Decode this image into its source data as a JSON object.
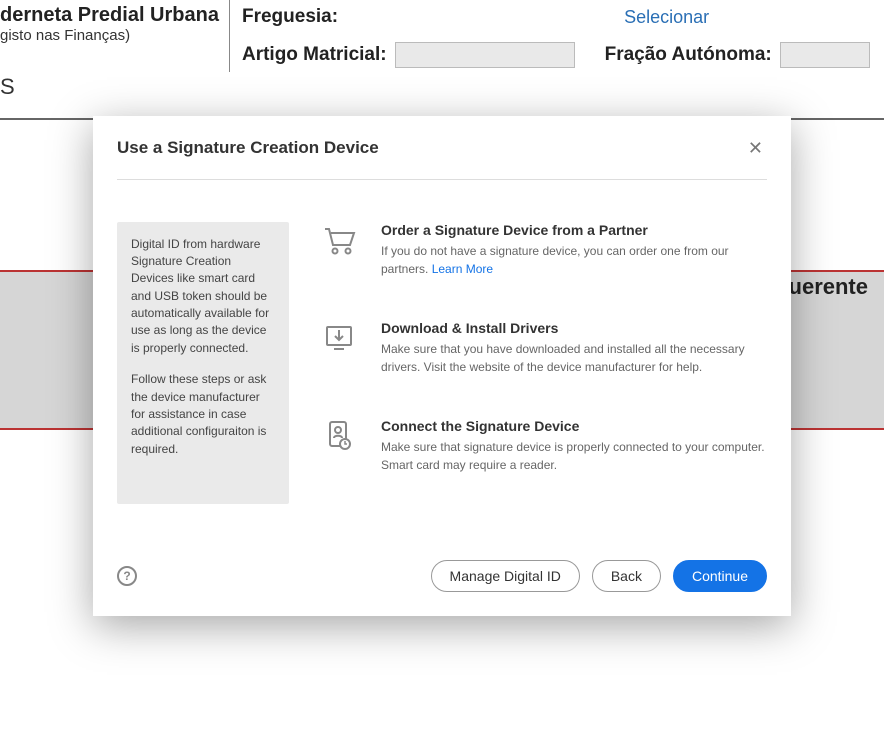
{
  "background": {
    "title_main": "derneta Predial Urbana",
    "title_sub": "gisto nas Finanças)",
    "field_freguesia_label": "Freguesia:",
    "field_freguesia_value": "Selecionar",
    "field_artigo_label": "Artigo Matricial:",
    "field_fracao_label": "Fração Autónoma:",
    "s_letter": "S",
    "uerente": "uerente"
  },
  "modal": {
    "title": "Use a Signature Creation Device",
    "close_symbol": "✕",
    "side_panel": {
      "p1": "Digital ID from hardware Signature Creation Devices like smart card and USB token should be automatically available for use as long as the device is properly connected.",
      "p2": "Follow these steps or ask the device manufacturer for assistance in case additional configuraiton is required."
    },
    "steps": {
      "order": {
        "title": "Order a Signature Device from a Partner",
        "desc": "If you do not have a signature device, you can order one from our partners. ",
        "link": "Learn More"
      },
      "download": {
        "title": "Download & Install Drivers",
        "desc": "Make sure that you have downloaded and installed all the necessary drivers. Visit the website of the device manufacturer for help."
      },
      "connect": {
        "title": "Connect the Signature Device",
        "desc": "Make sure that signature device is properly connected to your computer. Smart card may require a reader."
      }
    },
    "footer": {
      "help_symbol": "?",
      "manage_label": "Manage Digital ID",
      "back_label": "Back",
      "continue_label": "Continue"
    }
  }
}
